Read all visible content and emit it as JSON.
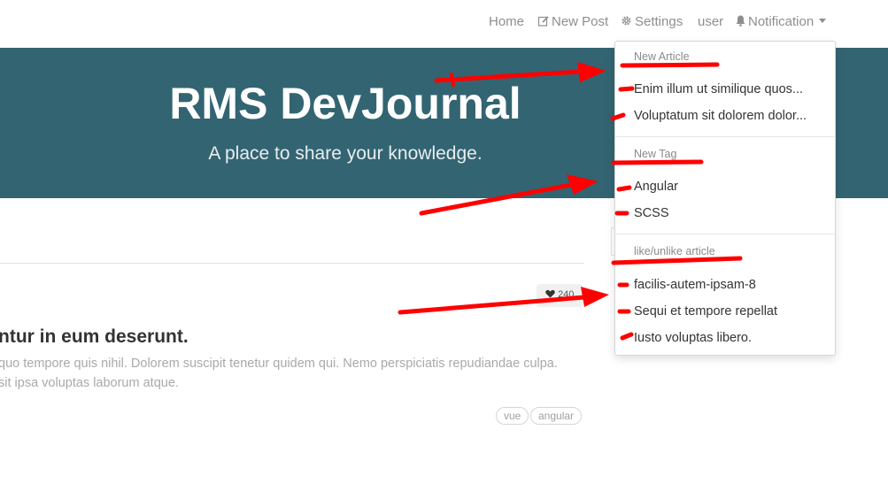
{
  "navbar": {
    "home": "Home",
    "new_post": "New Post",
    "settings": "Settings",
    "user": "user",
    "notification": "Notification"
  },
  "banner": {
    "title": "RMS DevJournal",
    "subtitle": "A place to share your knowledge."
  },
  "article": {
    "likes": "240",
    "title": "ntur in eum deserunt.",
    "description_line1": "quo tempore quis nihil. Dolorem suscipit tenetur quidem qui. Nemo perspiciatis repudiandae culpa.",
    "description_line2": "sit ipsa voluptas laborum atque.",
    "tags": [
      "vue",
      "angular"
    ]
  },
  "dropdown": {
    "sections": [
      {
        "header": "New Article",
        "items": [
          "Enim illum ut similique quos...",
          "Voluptatum sit dolorem dolor..."
        ]
      },
      {
        "header": "New Tag",
        "items": [
          "Angular",
          "SCSS"
        ]
      },
      {
        "header": "like/unlike article",
        "items": [
          "facilis-autem-ipsam-8",
          "Sequi et tempore repellat",
          "Iusto voluptas libero."
        ]
      }
    ]
  },
  "colors": {
    "banner_bg": "#336472",
    "annotation": "#ff0000",
    "nav_text": "#8e8e8e"
  },
  "icons": {
    "new_post": "edit-icon",
    "settings": "gear-icon",
    "notification": "bell-icon",
    "like": "heart-icon"
  }
}
